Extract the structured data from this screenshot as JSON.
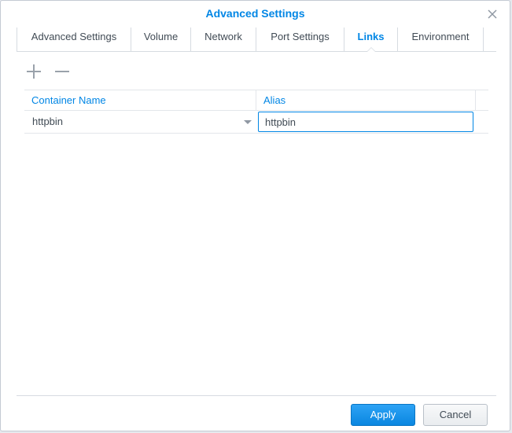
{
  "dialog": {
    "title": "Advanced Settings"
  },
  "tabs": [
    {
      "label": "Advanced Settings"
    },
    {
      "label": "Volume"
    },
    {
      "label": "Network"
    },
    {
      "label": "Port Settings"
    },
    {
      "label": "Links",
      "active": true
    },
    {
      "label": "Environment"
    }
  ],
  "toolbar": {
    "add_icon": "plus-icon",
    "remove_icon": "minus-icon"
  },
  "grid": {
    "columns": [
      "Container Name",
      "Alias"
    ],
    "rows": [
      {
        "container_name": "httpbin",
        "alias": "httpbin"
      }
    ]
  },
  "footer": {
    "apply_label": "Apply",
    "cancel_label": "Cancel"
  },
  "colors": {
    "accent": "#0086e5",
    "text": "#414b55",
    "border": "#d6dbe1"
  }
}
